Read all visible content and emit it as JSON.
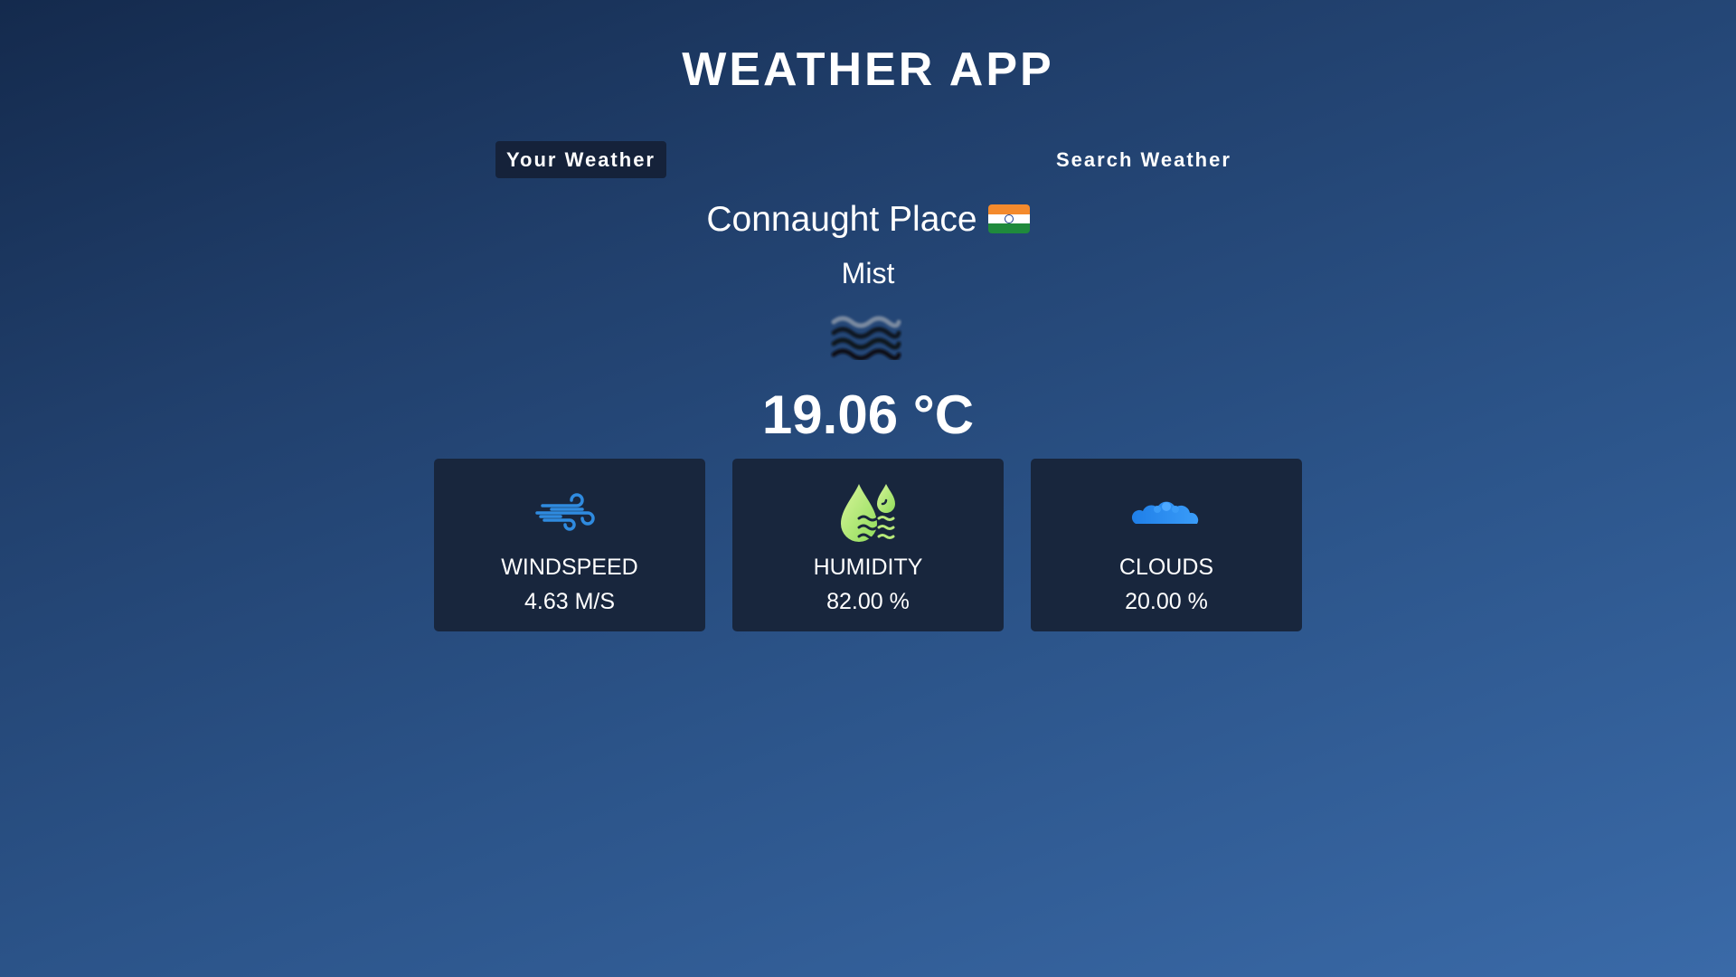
{
  "app": {
    "title": "WEATHER APP"
  },
  "tabs": [
    {
      "label": "Your Weather",
      "active": true
    },
    {
      "label": "Search Weather",
      "active": false
    }
  ],
  "weather": {
    "location": "Connaught Place",
    "country_flag": "india-flag-icon",
    "condition": "Mist",
    "condition_icon": "mist-icon",
    "temperature": "19.06 °C"
  },
  "stats": [
    {
      "label": "WINDSPEED",
      "value": "4.63 M/S",
      "icon": "wind-icon"
    },
    {
      "label": "HUMIDITY",
      "value": "82.00 %",
      "icon": "humidity-icon"
    },
    {
      "label": "CLOUDS",
      "value": "20.00 %",
      "icon": "cloud-icon"
    }
  ],
  "colors": {
    "background_top": "#142a4d",
    "background_bottom": "#3a6aa8",
    "card_bg": "#18263d",
    "active_tab_bg": "#15223a",
    "wind_icon": "#2f8be0",
    "humidity_icon": "#b8ea7a",
    "cloud_icon": "#2b8cf5"
  }
}
